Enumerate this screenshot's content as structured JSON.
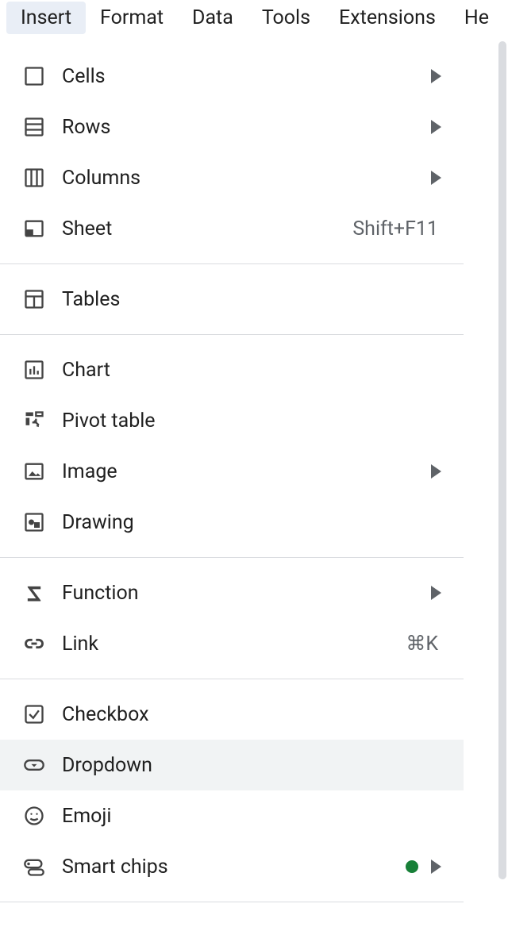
{
  "menubar": {
    "items": [
      "Insert",
      "Format",
      "Data",
      "Tools",
      "Extensions",
      "He"
    ],
    "activeIndex": 0
  },
  "menu": {
    "groups": [
      [
        {
          "icon": "cells",
          "label": "Cells",
          "submenu": true
        },
        {
          "icon": "rows",
          "label": "Rows",
          "submenu": true
        },
        {
          "icon": "columns",
          "label": "Columns",
          "submenu": true
        },
        {
          "icon": "sheet",
          "label": "Sheet",
          "shortcut": "Shift+F11"
        }
      ],
      [
        {
          "icon": "tables",
          "label": "Tables"
        }
      ],
      [
        {
          "icon": "chart",
          "label": "Chart"
        },
        {
          "icon": "pivot",
          "label": "Pivot table"
        },
        {
          "icon": "image",
          "label": "Image",
          "submenu": true
        },
        {
          "icon": "drawing",
          "label": "Drawing"
        }
      ],
      [
        {
          "icon": "function",
          "label": "Function",
          "submenu": true
        },
        {
          "icon": "link",
          "label": "Link",
          "shortcut": "⌘K"
        }
      ],
      [
        {
          "icon": "checkbox",
          "label": "Checkbox"
        },
        {
          "icon": "dropdown",
          "label": "Dropdown",
          "hover": true
        },
        {
          "icon": "emoji",
          "label": "Emoji"
        },
        {
          "icon": "smartchips",
          "label": "Smart chips",
          "dot": true,
          "submenu": true
        }
      ]
    ]
  }
}
